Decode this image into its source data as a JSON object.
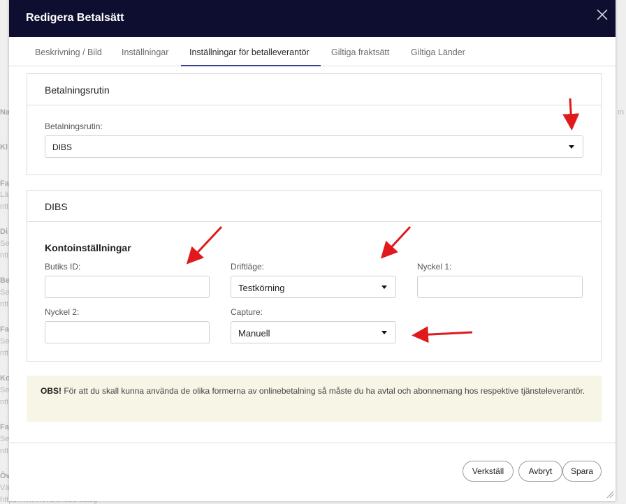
{
  "modal": {
    "title": "Redigera Betalsätt"
  },
  "tabs": [
    {
      "label": "Beskrivning / Bild"
    },
    {
      "label": "Inställningar"
    },
    {
      "label": "Inställningar för betalleverantör"
    },
    {
      "label": "Giltiga fraktsätt"
    },
    {
      "label": "Giltiga Länder"
    }
  ],
  "payment_routine": {
    "panel_title": "Betalningsrutin",
    "field_label": "Betalningsrutin:",
    "selected": "DIBS"
  },
  "dibs": {
    "panel_title": "DIBS",
    "section_label": "Kontoinställningar",
    "shop_id": {
      "label": "Butiks ID:",
      "value": ""
    },
    "mode": {
      "label": "Driftläge:",
      "selected": "Testkörning"
    },
    "key1": {
      "label": "Nyckel 1:",
      "value": ""
    },
    "key2": {
      "label": "Nyckel 2:",
      "value": ""
    },
    "capture": {
      "label": "Capture:",
      "selected": "Manuell"
    }
  },
  "notice": {
    "bold": "OBS!",
    "text": " För att du skall kunna använda de olika formerna av onlinebetalning så måste du ha avtal och abonnemang hos respektive tjänsteleverantör."
  },
  "buttons": {
    "apply": "Verkställ",
    "cancel": "Avbryt",
    "save": "Spara"
  },
  "background": {
    "url_text": "https://www.evalent.se/categ"
  },
  "colors": {
    "header_bg": "#0e0e30",
    "tab_underline": "#3b3f8f",
    "annotation_arrow": "#e0191c",
    "notice_bg": "#f7f5e5"
  },
  "icons": [
    "close-icon",
    "dropdown-caret-icon",
    "resize-handle-icon",
    "annotation-arrow"
  ]
}
